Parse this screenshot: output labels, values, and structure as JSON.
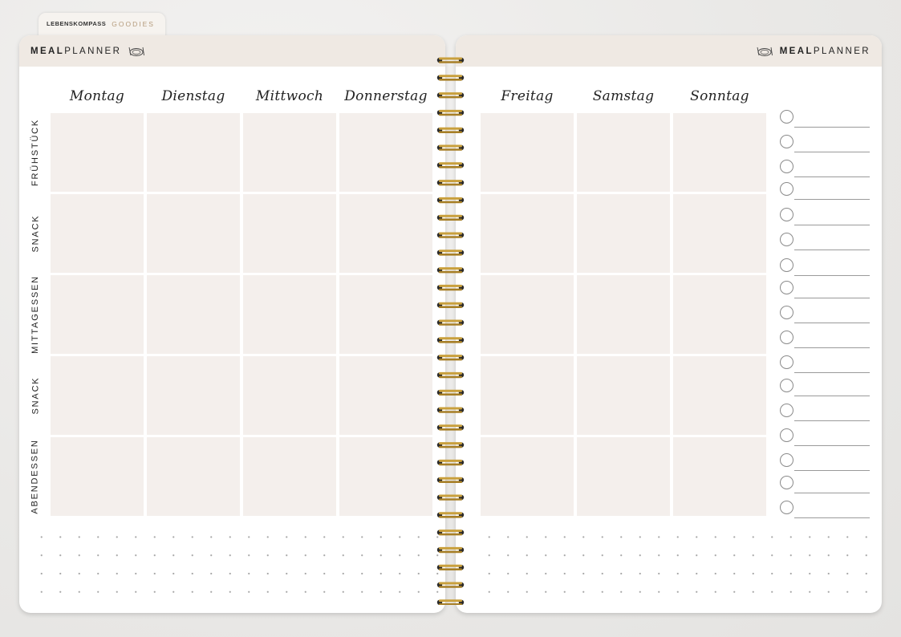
{
  "brand": {
    "name": "LEBENSKOMPASS",
    "tag": "GOODIES"
  },
  "header": {
    "title_bold": "MEAL",
    "title_rest": "PLANNER"
  },
  "days_left": [
    "Montag",
    "Dienstag",
    "Mittwoch",
    "Donnerstag"
  ],
  "days_right": [
    "Freitag",
    "Samstag",
    "Sonntag"
  ],
  "meals": [
    "FRÜHSTÜCK",
    "SNACK",
    "MITTAGESSEN",
    "SNACK",
    "ABENDESSEN"
  ],
  "colors": {
    "cell": "#f4efec",
    "header_band": "#efe9e3",
    "ring_gold": "#c9a03d",
    "ring_dark": "#2a2a2a"
  },
  "icons": {
    "plate": "plate-cutlery-icon",
    "check": "circle-checkbox-icon"
  }
}
